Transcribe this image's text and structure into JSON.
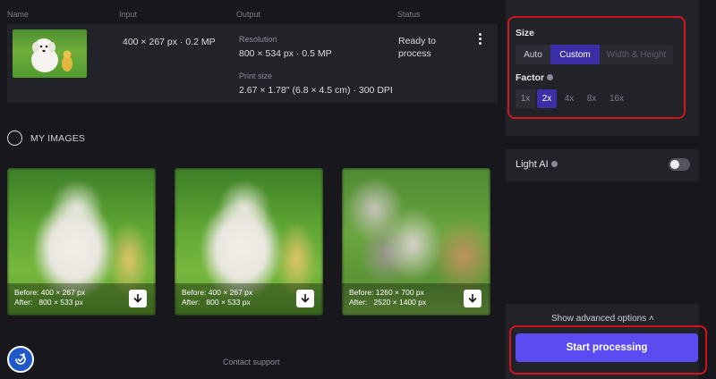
{
  "table": {
    "headers": [
      "Name",
      "Input",
      "Output",
      "Status"
    ],
    "row": {
      "input": "400 × 267 px · 0.2 MP",
      "resolution_label": "Resolution",
      "resolution_value": "800 × 534 px · 0.5 MP",
      "print_label": "Print size",
      "print_value": "2.67 × 1.78\" (6.8 × 4.5 cm) · 300 DPI",
      "status_line1": "Ready to",
      "status_line2": "process"
    }
  },
  "my_images": {
    "label": "MY IMAGES",
    "cards": [
      {
        "before": "Before: 400 × 267 px",
        "after": "After:   800 × 533 px"
      },
      {
        "before": "Before: 400 × 267 px",
        "after": "After:   800 × 533 px"
      },
      {
        "before": "Before: 1260 × 700 px",
        "after": "After:   2520 × 1400 px"
      }
    ]
  },
  "footer": {
    "support": "Contact support"
  },
  "settings": {
    "size_label": "Size",
    "size_options": [
      "Auto",
      "Custom",
      "Width & Height"
    ],
    "size_selected": "Custom",
    "factor_label": "Factor",
    "factor_options": [
      "1x",
      "2x",
      "4x",
      "8x",
      "16x"
    ],
    "factor_selected": "2x",
    "light_ai_label": "Light AI",
    "light_ai_enabled": false,
    "advanced_label": "Show advanced options  ˄",
    "start_label": "Start processing"
  },
  "colors": {
    "accent": "#5b4bf0",
    "selected_segment": "#3b2fa8",
    "highlight": "#d4141c",
    "background": "#17171c",
    "panel": "#222229"
  },
  "icons": [
    "kebab-menu-icon",
    "radio-circle-icon",
    "info-icon",
    "download-icon",
    "accessibility-icon"
  ]
}
